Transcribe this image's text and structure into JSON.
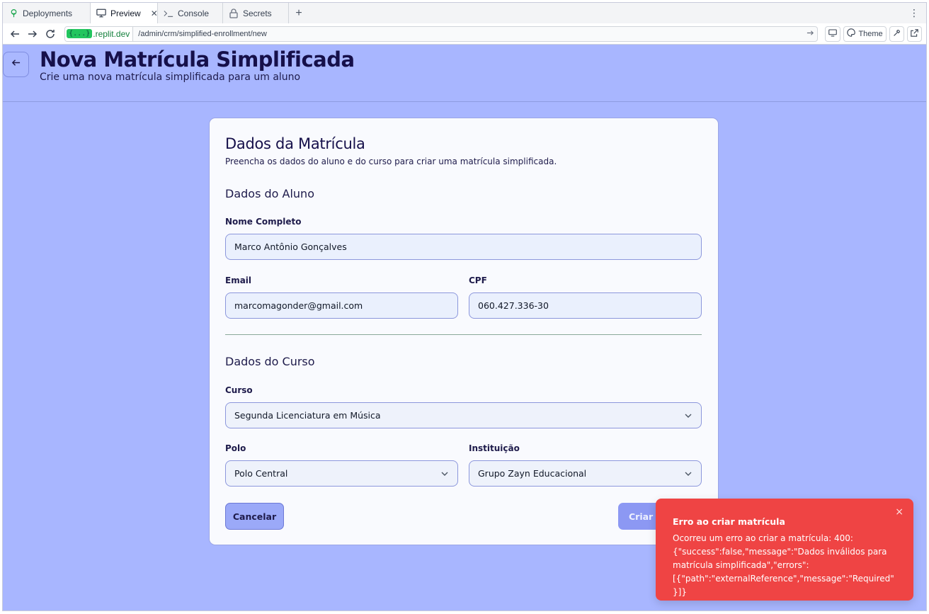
{
  "browser": {
    "tabs": [
      {
        "label": "Deployments",
        "icon": "tree-icon"
      },
      {
        "label": "Preview",
        "icon": "monitor-icon",
        "active": true
      },
      {
        "label": "Console",
        "icon": "terminal-icon"
      },
      {
        "label": "Secrets",
        "icon": "lock-icon"
      }
    ],
    "address": {
      "domain_badge": "{...}",
      "domain": ".replit.dev",
      "path": "/admin/crm/simplified-enrollment/new"
    },
    "theme_label": "Theme"
  },
  "header": {
    "title": "Nova Matrícula Simplificada",
    "subtitle": "Crie uma nova matrícula simplificada para um aluno"
  },
  "form": {
    "title": "Dados da Matrícula",
    "description": "Preencha os dados do aluno e do curso para criar uma matrícula simplificada.",
    "student_section": "Dados do Aluno",
    "course_section": "Dados do Curso",
    "fields": {
      "name": {
        "label": "Nome Completo",
        "value": "Marco Antônio Gonçalves"
      },
      "email": {
        "label": "Email",
        "value": "marcomagonder@gmail.com"
      },
      "cpf": {
        "label": "CPF",
        "value": "060.427.336-30"
      },
      "course": {
        "label": "Curso",
        "value": "Segunda Licenciatura em Música"
      },
      "polo": {
        "label": "Polo",
        "value": "Polo Central"
      },
      "institution": {
        "label": "Instituição",
        "value": "Grupo Zayn Educacional"
      }
    },
    "cancel_label": "Cancelar",
    "submit_label": "Criar Matrícula"
  },
  "toast": {
    "title": "Erro ao criar matrícula",
    "message": "Ocorreu um erro ao criar a matrícula: 400: {\"success\":false,\"message\":\"Dados inválidos para matrícula simplificada\",\"errors\":[{\"path\":\"externalReference\",\"message\":\"Required\"}]}",
    "close": "×"
  },
  "colors": {
    "page_bg": "#a8b6ff",
    "card_bg": "#f9fafe",
    "title": "#16104a",
    "toast_bg": "#ef4444"
  }
}
